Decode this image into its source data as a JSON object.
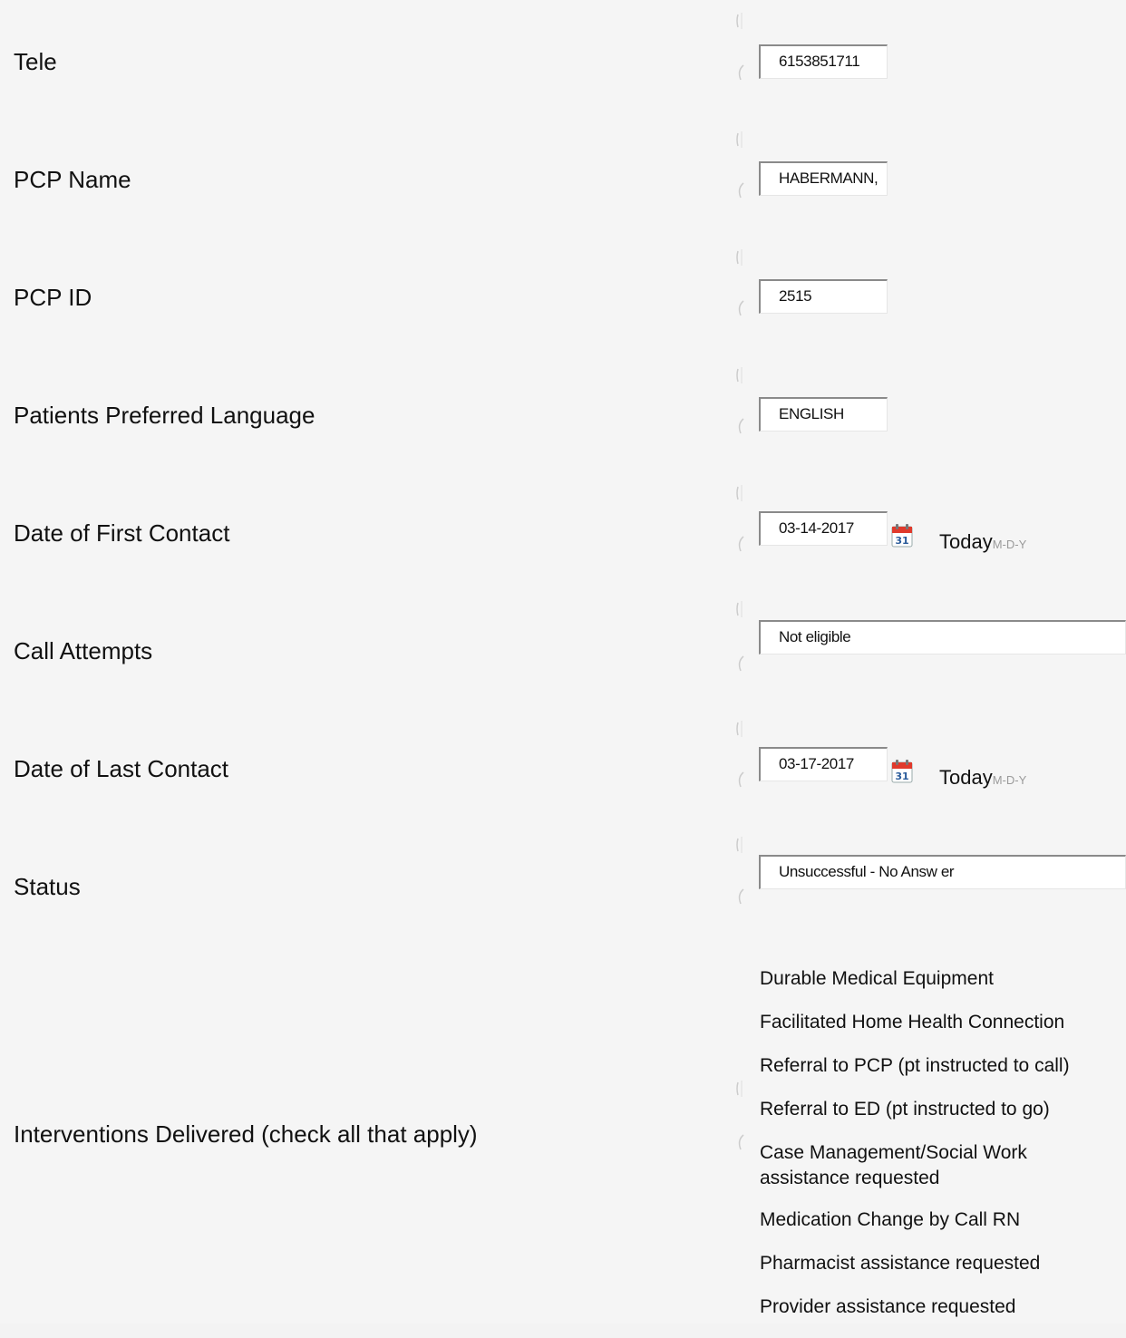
{
  "rows": [
    {
      "label": "Tele",
      "value": "6153851711"
    },
    {
      "label": "PCP Name",
      "value": "HABERMANN,"
    },
    {
      "label": "PCP ID",
      "value": "2515"
    },
    {
      "label": "Patients Preferred Language",
      "value": "ENGLISH"
    },
    {
      "label": "Date of First Contact",
      "value": "03-14-2017",
      "today": "Today",
      "format": "M-D-Y"
    },
    {
      "label": "Call Attempts",
      "value": "Not eligible"
    },
    {
      "label": "Date of Last Contact",
      "value": "03-17-2017",
      "today": "Today",
      "format": "M-D-Y"
    },
    {
      "label": "Status",
      "value": "Unsuccessful - No Answ er"
    }
  ],
  "interventions": {
    "label": "Interventions Delivered (check all that apply)",
    "options": [
      "Durable Medical Equipment",
      "Facilitated Home Health Connection",
      "Referral to PCP (pt instructed to call)",
      "Referral to ED (pt instructed to go)",
      "Case Management/Social Work assistance requested",
      "Medication Change by Call RN",
      "Pharmacist assistance requested",
      "Provider assistance requested"
    ]
  },
  "icons": {
    "calendar": "calendar-icon",
    "calendar_day": "31"
  }
}
